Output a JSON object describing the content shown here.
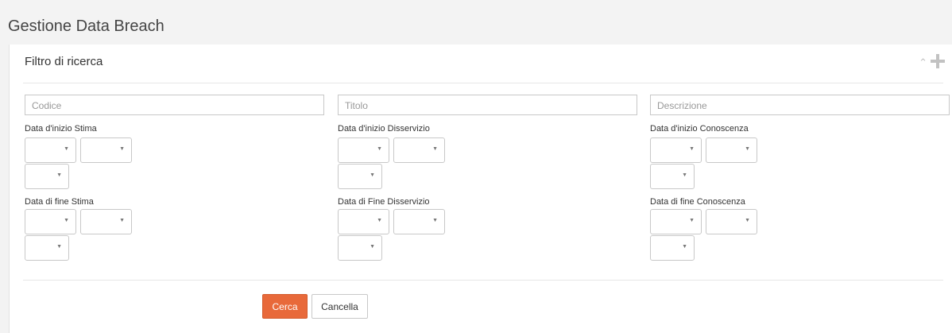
{
  "page_title": "Gestione Data Breach",
  "panel": {
    "title": "Filtro di ricerca",
    "collapse_icon": "chevron-up-icon",
    "add_icon": "plus-icon"
  },
  "fields": {
    "codice_placeholder": "Codice",
    "titolo_placeholder": "Titolo",
    "descrizione_placeholder": "Descrizione"
  },
  "dates": {
    "inizio_stima": "Data d'inizio Stima",
    "inizio_disservizio": "Data d'inizio Disservizio",
    "inizio_conoscenza": "Data d'inizio Conoscenza",
    "fine_stima": "Data di fine Stima",
    "fine_disservizio": "Data di Fine Disservizio",
    "fine_conoscenza": "Data di fine Conoscenza"
  },
  "buttons": {
    "search": "Cerca",
    "cancel": "Cancella"
  },
  "colors": {
    "accent": "#e8693a"
  }
}
